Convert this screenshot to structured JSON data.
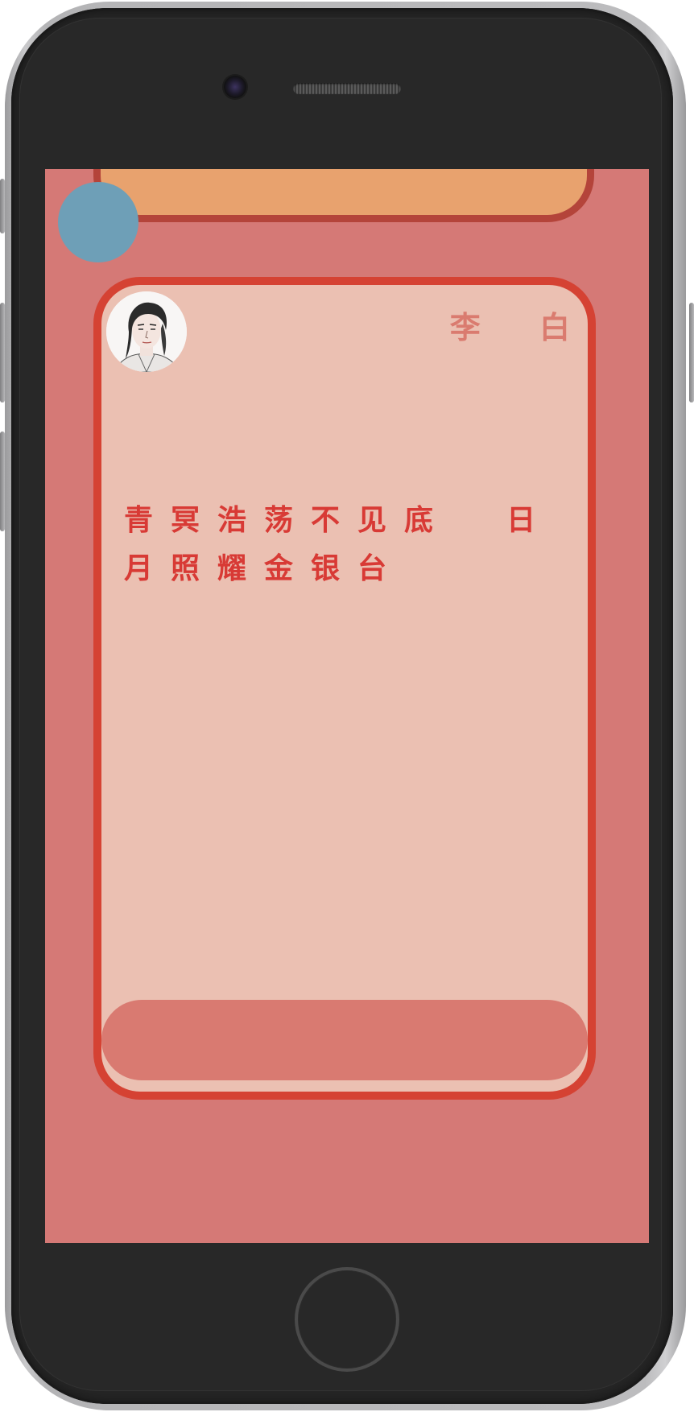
{
  "author": {
    "name": "李 白"
  },
  "poem": {
    "text": "青冥浩荡不见底  日月照耀金银台"
  },
  "icons": {
    "avatar": "portrait-avatar-icon",
    "round_button": "circle-button",
    "home_button": "home-button-ring",
    "camera": "front-camera",
    "speaker": "earpiece-speaker"
  },
  "colors": {
    "screen_background": "#d57976",
    "card_background": "#ebc0b2",
    "card_border": "#d54233",
    "top_bar": "#e8a26e",
    "top_bar_border": "#b4443a",
    "round_button": "#6e9fb7",
    "bottom_bar": "#d97a71",
    "poem_text": "#d83a35",
    "author_text": "#da7b6f"
  }
}
